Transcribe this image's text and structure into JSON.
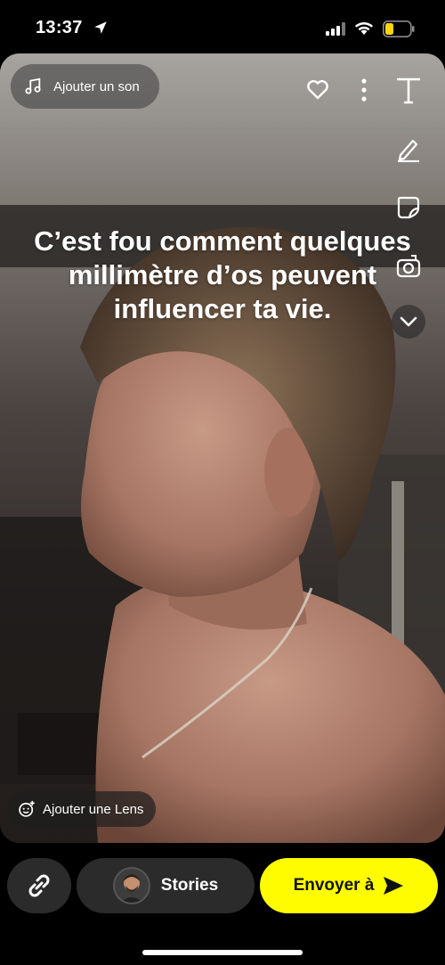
{
  "status_bar": {
    "time": "13:37",
    "location_icon": "location-arrow-icon",
    "signal_icon": "cellular-signal-icon",
    "wifi_icon": "wifi-icon",
    "battery_icon": "battery-low-icon",
    "battery_color": "#ffd60a"
  },
  "editor": {
    "add_sound_label": "Ajouter un son",
    "add_sound_icon": "music-note-icon",
    "caption": "C’est fou comment quelques millimètre d’os peuvent influencer ta vie.",
    "add_lens_label": "Ajouter une Lens",
    "tools": [
      "heart-icon",
      "more-icon",
      "text-tool-icon",
      "pen-icon",
      "sticker-icon",
      "camera-switch-icon",
      "chevron-down-icon"
    ]
  },
  "bottom_bar": {
    "link_icon": "link-icon",
    "stories_label": "Stories",
    "send_label": "Envoyer à",
    "send_icon": "send-arrow-icon",
    "send_color": "#fffc00"
  }
}
